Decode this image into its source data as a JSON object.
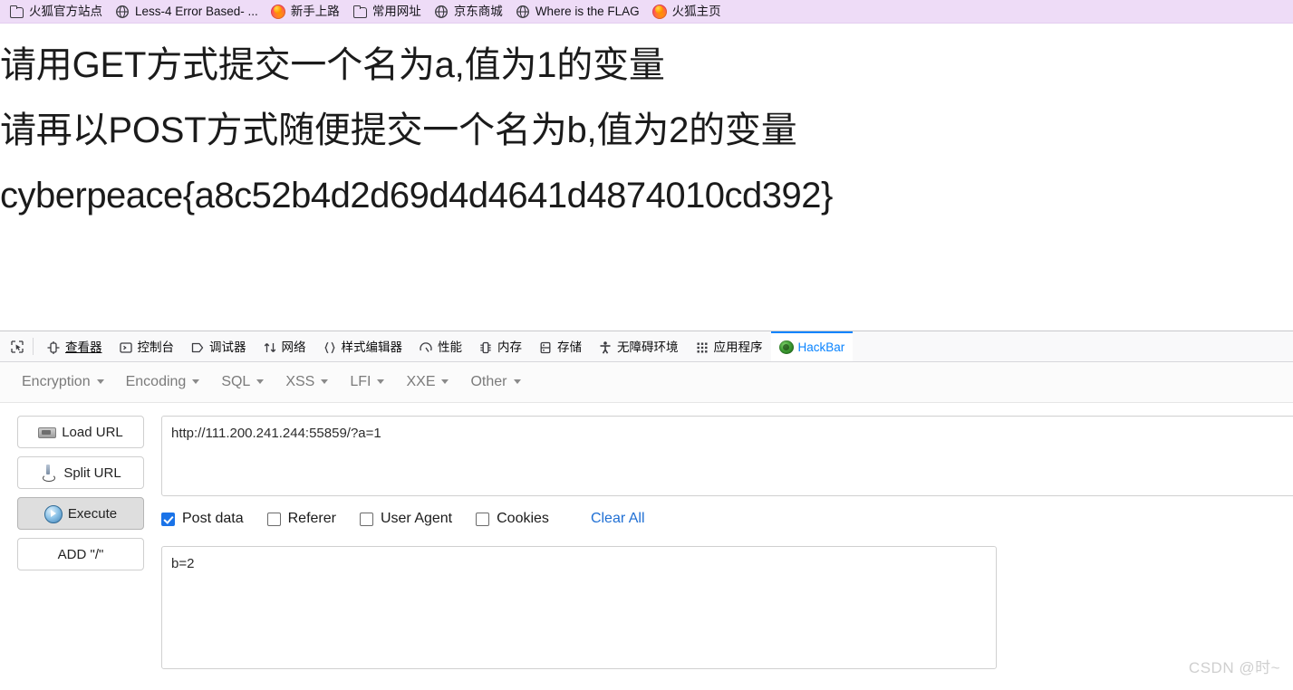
{
  "bookmarks_bar": {
    "items": [
      {
        "label": "火狐官方站点",
        "icon": "folder-icon"
      },
      {
        "label": "Less-4 Error Based- ...",
        "icon": "globe-icon"
      },
      {
        "label": "新手上路",
        "icon": "firefox-icon"
      },
      {
        "label": "常用网址",
        "icon": "folder-icon"
      },
      {
        "label": "京东商城",
        "icon": "globe-icon"
      },
      {
        "label": "Where is the FLAG",
        "icon": "globe-icon"
      },
      {
        "label": "火狐主页",
        "icon": "firefox-icon"
      }
    ],
    "background_color": "#eedcf7"
  },
  "page": {
    "lines": [
      "请用GET方式提交一个名为a,值为1的变量",
      "请再以POST方式随便提交一个名为b,值为2的变量",
      "cyberpeace{a8c52b4d2d69d4d4641d4874010cd392}"
    ],
    "flag": "cyberpeace{a8c52b4d2d69d4d4641d4874010cd392}"
  },
  "devtools": {
    "picker_icon": "element-picker-icon",
    "tabs": [
      {
        "label": "查看器",
        "icon": "inspector-icon",
        "active": false,
        "hovered": true
      },
      {
        "label": "控制台",
        "icon": "console-icon",
        "active": false,
        "hovered": false
      },
      {
        "label": "调试器",
        "icon": "debugger-icon",
        "active": false,
        "hovered": false
      },
      {
        "label": "网络",
        "icon": "network-icon",
        "active": false,
        "hovered": false
      },
      {
        "label": "样式编辑器",
        "icon": "style-editor-icon",
        "active": false,
        "hovered": false
      },
      {
        "label": "性能",
        "icon": "performance-icon",
        "active": false,
        "hovered": false
      },
      {
        "label": "内存",
        "icon": "memory-icon",
        "active": false,
        "hovered": false
      },
      {
        "label": "存储",
        "icon": "storage-icon",
        "active": false,
        "hovered": false
      },
      {
        "label": "无障碍环境",
        "icon": "accessibility-icon",
        "active": false,
        "hovered": false
      },
      {
        "label": "应用程序",
        "icon": "application-icon",
        "active": false,
        "hovered": false
      },
      {
        "label": "HackBar",
        "icon": "hackbar-icon",
        "active": true,
        "hovered": false
      }
    ],
    "active_tab_accent": "#0a84ff"
  },
  "hackbar": {
    "menus": [
      {
        "label": "Encryption"
      },
      {
        "label": "Encoding"
      },
      {
        "label": "SQL"
      },
      {
        "label": "XSS"
      },
      {
        "label": "LFI"
      },
      {
        "label": "XXE"
      },
      {
        "label": "Other"
      }
    ],
    "buttons": [
      {
        "label": "Load URL",
        "icon": "load-url-icon",
        "pressed": false
      },
      {
        "label": "Split URL",
        "icon": "split-url-icon",
        "pressed": false
      },
      {
        "label": "Execute",
        "icon": "execute-icon",
        "pressed": true
      },
      {
        "label": "ADD \"/\"",
        "icon": "none",
        "pressed": false
      }
    ],
    "url_field": {
      "value": "http://111.200.241.244:55859/?a=1",
      "placeholder": ""
    },
    "options": [
      {
        "label": "Post data",
        "checked": true
      },
      {
        "label": "Referer",
        "checked": false
      },
      {
        "label": "User Agent",
        "checked": false
      },
      {
        "label": "Cookies",
        "checked": false
      }
    ],
    "clear_all_label": "Clear All",
    "clear_all_color": "#1f6fd4",
    "post_data_field": {
      "value": "b=2",
      "placeholder": ""
    }
  },
  "watermark": {
    "text": "CSDN @时~"
  }
}
